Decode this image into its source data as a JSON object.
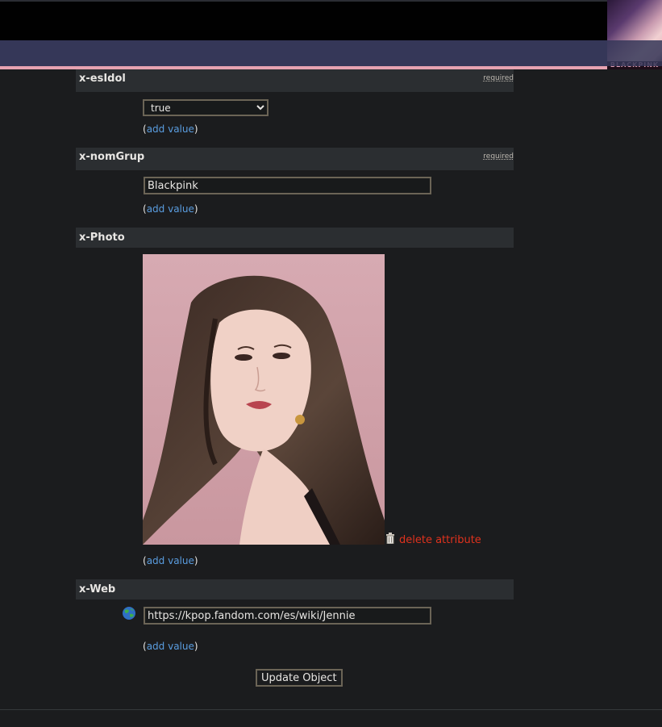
{
  "attributes": [
    {
      "name": "x-esIdol",
      "required_label": "required",
      "select_value": "true",
      "add_value_label": "add value"
    },
    {
      "name": "x-nomGrup",
      "required_label": "required",
      "input_value": "Blackpink",
      "add_value_label": "add value"
    },
    {
      "name": "x-Photo",
      "delete_label": "delete attribute",
      "add_value_label": "add value"
    },
    {
      "name": "x-Web",
      "input_value": "https://kpop.fandom.com/es/wiki/Jennie",
      "add_value_label": "add value"
    }
  ],
  "corner_banner_text": "BLACKPINK",
  "submit_label": "Update Object",
  "colors": {
    "nav": "#353758",
    "accent_pink": "#e6a2b1",
    "link": "#5a9de0",
    "delete": "#e0321d"
  },
  "icons": [
    "trash-icon",
    "globe-icon",
    "chevron-down-icon"
  ]
}
